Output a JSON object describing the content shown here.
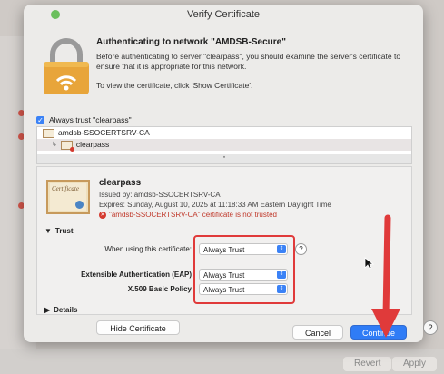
{
  "window": {
    "title": "Verify Certificate"
  },
  "header": {
    "heading": "Authenticating to network \"AMDSB-Secure\"",
    "description": "Before authenticating to server \"clearpass\", you should examine the server's certificate to ensure that it is appropriate for this network.",
    "hint": "To view the certificate, click 'Show Certificate'."
  },
  "always_trust": {
    "label": "Always trust \"clearpass\"",
    "checked": true
  },
  "tree": {
    "items": [
      {
        "label": "amdsb-SSOCERTSRV-CA",
        "level": 0
      },
      {
        "label": "clearpass",
        "level": 1
      }
    ]
  },
  "cert": {
    "badge_title": "Certificate",
    "name": "clearpass",
    "issued_by": "Issued by: amdsb-SSOCERTSRV-CA",
    "expires": "Expires: Sunday, August 10, 2025 at 11:18:33 AM Eastern Daylight Time",
    "warning": "\"amdsb-SSOCERTSRV-CA\" certificate is not trusted"
  },
  "trust": {
    "section_label": "Trust",
    "rows": [
      {
        "label": "When using this certificate:",
        "value": "Always Trust"
      },
      {
        "label": "Extensible Authentication (EAP)",
        "value": "Always Trust"
      },
      {
        "label": "X.509 Basic Policy",
        "value": "Always Trust"
      }
    ]
  },
  "details": {
    "section_label": "Details"
  },
  "buttons": {
    "hide_certificate": "Hide Certificate",
    "cancel": "Cancel",
    "continue": "Continue",
    "help": "?"
  },
  "background": {
    "revert": "Revert",
    "apply": "Apply"
  },
  "colors": {
    "accent": "#2f7cf6",
    "warning": "#d43a2f",
    "annotation": "#e03a3a"
  }
}
